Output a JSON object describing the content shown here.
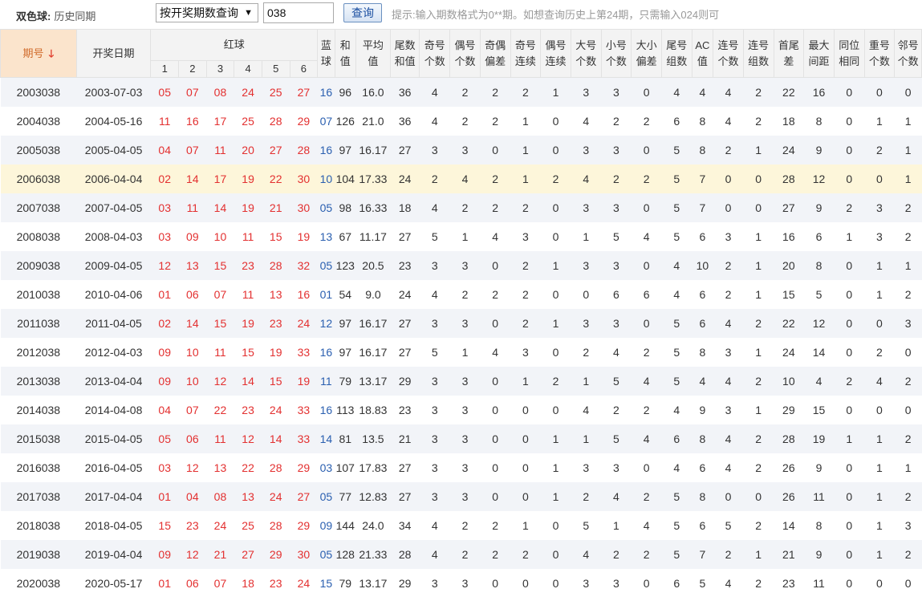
{
  "toolbar": {
    "title_bold": "双色球:",
    "title_rest": "历史同期",
    "mode_select": "按开奖期数查询",
    "period_input": "038",
    "query_button": "查询",
    "hint": "提示:输入期数格式为0**期。如想查询历史上第24期，只需输入024则可"
  },
  "headers": {
    "period": "期号",
    "sort_icon": "arrow-down-icon",
    "date": "开奖日期",
    "red": "红球",
    "red_cols": [
      "1",
      "2",
      "3",
      "4",
      "5",
      "6"
    ],
    "stats": [
      [
        "蓝",
        "球"
      ],
      [
        "和",
        "值"
      ],
      [
        "平均",
        "值"
      ],
      [
        "尾数",
        "和值"
      ],
      [
        "奇号",
        "个数"
      ],
      [
        "偶号",
        "个数"
      ],
      [
        "奇偶",
        "偏差"
      ],
      [
        "奇号",
        "连续"
      ],
      [
        "偶号",
        "连续"
      ],
      [
        "大号",
        "个数"
      ],
      [
        "小号",
        "个数"
      ],
      [
        "大小",
        "偏差"
      ],
      [
        "尾号",
        "组数"
      ],
      [
        "AC",
        "值"
      ],
      [
        "连号",
        "个数"
      ],
      [
        "连号",
        "组数"
      ],
      [
        "首尾",
        "差"
      ],
      [
        "最大",
        "间距"
      ],
      [
        "同位",
        "相同"
      ],
      [
        "重号",
        "个数"
      ],
      [
        "邻号",
        "个数"
      ]
    ]
  },
  "colors": {
    "red": "#e33030",
    "blue": "#2a5fb0",
    "highlight": "#fdf6da",
    "sort": "#e03c2c"
  },
  "rows": [
    [
      "2003038",
      "2003-07-03",
      "05",
      "07",
      "08",
      "24",
      "25",
      "27",
      "16",
      "96",
      "16.0",
      "36",
      "4",
      "2",
      "2",
      "2",
      "1",
      "3",
      "3",
      "0",
      "4",
      "4",
      "4",
      "2",
      "22",
      "16",
      "0",
      "0",
      "0"
    ],
    [
      "2004038",
      "2004-05-16",
      "11",
      "16",
      "17",
      "25",
      "28",
      "29",
      "07",
      "126",
      "21.0",
      "36",
      "4",
      "2",
      "2",
      "1",
      "0",
      "4",
      "2",
      "2",
      "6",
      "8",
      "4",
      "2",
      "18",
      "8",
      "0",
      "1",
      "1"
    ],
    [
      "2005038",
      "2005-04-05",
      "04",
      "07",
      "11",
      "20",
      "27",
      "28",
      "16",
      "97",
      "16.17",
      "27",
      "3",
      "3",
      "0",
      "1",
      "0",
      "3",
      "3",
      "0",
      "5",
      "8",
      "2",
      "1",
      "24",
      "9",
      "0",
      "2",
      "1"
    ],
    [
      "2006038",
      "2006-04-04",
      "02",
      "14",
      "17",
      "19",
      "22",
      "30",
      "10",
      "104",
      "17.33",
      "24",
      "2",
      "4",
      "2",
      "1",
      "2",
      "4",
      "2",
      "2",
      "5",
      "7",
      "0",
      "0",
      "28",
      "12",
      "0",
      "0",
      "1"
    ],
    [
      "2007038",
      "2007-04-05",
      "03",
      "11",
      "14",
      "19",
      "21",
      "30",
      "05",
      "98",
      "16.33",
      "18",
      "4",
      "2",
      "2",
      "2",
      "0",
      "3",
      "3",
      "0",
      "5",
      "7",
      "0",
      "0",
      "27",
      "9",
      "2",
      "3",
      "2"
    ],
    [
      "2008038",
      "2008-04-03",
      "03",
      "09",
      "10",
      "11",
      "15",
      "19",
      "13",
      "67",
      "11.17",
      "27",
      "5",
      "1",
      "4",
      "3",
      "0",
      "1",
      "5",
      "4",
      "5",
      "6",
      "3",
      "1",
      "16",
      "6",
      "1",
      "3",
      "2"
    ],
    [
      "2009038",
      "2009-04-05",
      "12",
      "13",
      "15",
      "23",
      "28",
      "32",
      "05",
      "123",
      "20.5",
      "23",
      "3",
      "3",
      "0",
      "2",
      "1",
      "3",
      "3",
      "0",
      "4",
      "10",
      "2",
      "1",
      "20",
      "8",
      "0",
      "1",
      "1"
    ],
    [
      "2010038",
      "2010-04-06",
      "01",
      "06",
      "07",
      "11",
      "13",
      "16",
      "01",
      "54",
      "9.0",
      "24",
      "4",
      "2",
      "2",
      "2",
      "0",
      "0",
      "6",
      "6",
      "4",
      "6",
      "2",
      "1",
      "15",
      "5",
      "0",
      "1",
      "2"
    ],
    [
      "2011038",
      "2011-04-05",
      "02",
      "14",
      "15",
      "19",
      "23",
      "24",
      "12",
      "97",
      "16.17",
      "27",
      "3",
      "3",
      "0",
      "2",
      "1",
      "3",
      "3",
      "0",
      "5",
      "6",
      "4",
      "2",
      "22",
      "12",
      "0",
      "0",
      "3"
    ],
    [
      "2012038",
      "2012-04-03",
      "09",
      "10",
      "11",
      "15",
      "19",
      "33",
      "16",
      "97",
      "16.17",
      "27",
      "5",
      "1",
      "4",
      "3",
      "0",
      "2",
      "4",
      "2",
      "5",
      "8",
      "3",
      "1",
      "24",
      "14",
      "0",
      "2",
      "0"
    ],
    [
      "2013038",
      "2013-04-04",
      "09",
      "10",
      "12",
      "14",
      "15",
      "19",
      "11",
      "79",
      "13.17",
      "29",
      "3",
      "3",
      "0",
      "1",
      "2",
      "1",
      "5",
      "4",
      "5",
      "4",
      "4",
      "2",
      "10",
      "4",
      "2",
      "4",
      "2"
    ],
    [
      "2014038",
      "2014-04-08",
      "04",
      "07",
      "22",
      "23",
      "24",
      "33",
      "16",
      "113",
      "18.83",
      "23",
      "3",
      "3",
      "0",
      "0",
      "0",
      "4",
      "2",
      "2",
      "4",
      "9",
      "3",
      "1",
      "29",
      "15",
      "0",
      "0",
      "0"
    ],
    [
      "2015038",
      "2015-04-05",
      "05",
      "06",
      "11",
      "12",
      "14",
      "33",
      "14",
      "81",
      "13.5",
      "21",
      "3",
      "3",
      "0",
      "0",
      "1",
      "1",
      "5",
      "4",
      "6",
      "8",
      "4",
      "2",
      "28",
      "19",
      "1",
      "1",
      "2"
    ],
    [
      "2016038",
      "2016-04-05",
      "03",
      "12",
      "13",
      "22",
      "28",
      "29",
      "03",
      "107",
      "17.83",
      "27",
      "3",
      "3",
      "0",
      "0",
      "1",
      "3",
      "3",
      "0",
      "4",
      "6",
      "4",
      "2",
      "26",
      "9",
      "0",
      "1",
      "1"
    ],
    [
      "2017038",
      "2017-04-04",
      "01",
      "04",
      "08",
      "13",
      "24",
      "27",
      "05",
      "77",
      "12.83",
      "27",
      "3",
      "3",
      "0",
      "0",
      "1",
      "2",
      "4",
      "2",
      "5",
      "8",
      "0",
      "0",
      "26",
      "11",
      "0",
      "1",
      "2"
    ],
    [
      "2018038",
      "2018-04-05",
      "15",
      "23",
      "24",
      "25",
      "28",
      "29",
      "09",
      "144",
      "24.0",
      "34",
      "4",
      "2",
      "2",
      "1",
      "0",
      "5",
      "1",
      "4",
      "5",
      "6",
      "5",
      "2",
      "14",
      "8",
      "0",
      "1",
      "3"
    ],
    [
      "2019038",
      "2019-04-04",
      "09",
      "12",
      "21",
      "27",
      "29",
      "30",
      "05",
      "128",
      "21.33",
      "28",
      "4",
      "2",
      "2",
      "2",
      "0",
      "4",
      "2",
      "2",
      "5",
      "7",
      "2",
      "1",
      "21",
      "9",
      "0",
      "1",
      "2"
    ],
    [
      "2020038",
      "2020-05-17",
      "01",
      "06",
      "07",
      "18",
      "23",
      "24",
      "15",
      "79",
      "13.17",
      "29",
      "3",
      "3",
      "0",
      "0",
      "0",
      "3",
      "3",
      "0",
      "6",
      "5",
      "4",
      "2",
      "23",
      "11",
      "0",
      "0",
      "0"
    ]
  ],
  "highlight_row": 3
}
